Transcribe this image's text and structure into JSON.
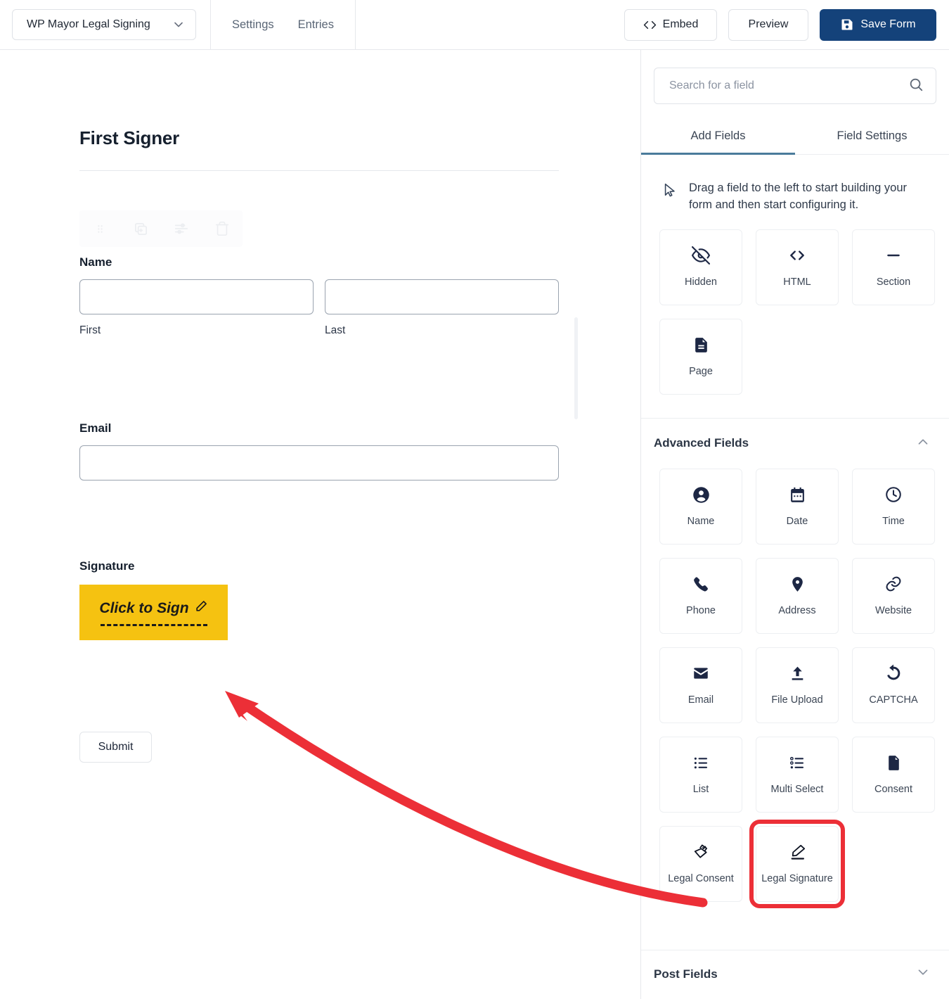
{
  "topbar": {
    "form_name": "WP Mayor Legal Signing",
    "form_select_icon": "chevron-down-icon",
    "nav": [
      {
        "label": "Settings"
      },
      {
        "label": "Entries"
      }
    ],
    "actions": {
      "embed": {
        "label": "Embed",
        "icon": "code-icon"
      },
      "preview": {
        "label": "Preview"
      },
      "save": {
        "label": "Save Form",
        "icon": "floppy-disk-icon",
        "color": "#14427a"
      }
    }
  },
  "canvas": {
    "title": "First Signer",
    "field_toolbar": [
      {
        "icon": "drag-handle-icon"
      },
      {
        "icon": "duplicate-icon"
      },
      {
        "icon": "settings-sliders-icon"
      },
      {
        "icon": "trash-icon"
      }
    ],
    "fields": {
      "name": {
        "label": "Name",
        "first_sublabel": "First",
        "last_sublabel": "Last",
        "first_value": "",
        "last_value": ""
      },
      "email": {
        "label": "Email",
        "value": ""
      },
      "signature": {
        "label": "Signature",
        "button_text": "Click to Sign",
        "button_icon": "pen-icon",
        "button_color": "#F5C211"
      }
    },
    "submit": {
      "label": "Submit"
    }
  },
  "panel": {
    "search": {
      "placeholder": "Search for a field",
      "value": "",
      "icon": "search-icon"
    },
    "tabs": [
      {
        "label": "Add Fields",
        "active": true
      },
      {
        "label": "Field Settings",
        "active": false
      }
    ],
    "active_tab_color": "#4a7b9b",
    "hint": {
      "icon": "cursor-arrow-icon",
      "text": "Drag a field to the left to start building your form and then start configuring it."
    },
    "standard_fields": [
      {
        "label": "Hidden",
        "icon": "eye-off-icon"
      },
      {
        "label": "HTML",
        "icon": "code-brackets-icon"
      },
      {
        "label": "Section",
        "icon": "minus-line-icon"
      },
      {
        "label": "Page",
        "icon": "page-document-icon"
      }
    ],
    "advanced_section": {
      "title": "Advanced Fields",
      "chevron": "chevron-up-icon",
      "fields": [
        {
          "label": "Name",
          "icon": "user-circle-icon"
        },
        {
          "label": "Date",
          "icon": "calendar-icon"
        },
        {
          "label": "Time",
          "icon": "clock-icon"
        },
        {
          "label": "Phone",
          "icon": "phone-icon"
        },
        {
          "label": "Address",
          "icon": "map-pin-icon"
        },
        {
          "label": "Website",
          "icon": "link-icon"
        },
        {
          "label": "Email",
          "icon": "envelope-icon"
        },
        {
          "label": "File Upload",
          "icon": "upload-icon"
        },
        {
          "label": "CAPTCHA",
          "icon": "captcha-refresh-icon"
        },
        {
          "label": "List",
          "icon": "list-icon"
        },
        {
          "label": "Multi Select",
          "icon": "multi-select-icon"
        },
        {
          "label": "Consent",
          "icon": "document-icon"
        },
        {
          "label": "Legal Consent",
          "icon": "legal-consent-icon"
        },
        {
          "label": "Legal Signature",
          "icon": "legal-signature-pen-icon",
          "highlighted": true
        }
      ]
    },
    "post_section": {
      "title": "Post Fields",
      "chevron": "chevron-down-icon"
    }
  },
  "annotation": {
    "arrow_color": "#EC2F37",
    "highlight_color": "#EC2F37"
  }
}
